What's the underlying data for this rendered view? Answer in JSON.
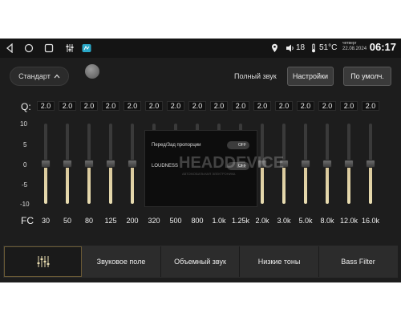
{
  "status_bar": {
    "volume": "18",
    "temperature": "51°C",
    "day": "четверг",
    "date": "22.08.2024",
    "time": "06:17",
    "icons": [
      "back-icon",
      "home-icon",
      "recent-apps-icon",
      "equalizer-icon",
      "app-icon",
      "location-icon",
      "volume-icon",
      "temperature-icon"
    ]
  },
  "top": {
    "preset": "Стандарт",
    "full_sound": "Полный звук",
    "settings": "Настройки",
    "default": "По умолч."
  },
  "eq": {
    "q_label": "Q:",
    "fc_label": "FC",
    "scale": [
      "10",
      "5",
      "0",
      "-5",
      "-10"
    ],
    "bands": [
      {
        "q": "2.0",
        "freq": "30",
        "gain": 0
      },
      {
        "q": "2.0",
        "freq": "50",
        "gain": 0
      },
      {
        "q": "2.0",
        "freq": "80",
        "gain": 0
      },
      {
        "q": "2.0",
        "freq": "125",
        "gain": 0
      },
      {
        "q": "2.0",
        "freq": "200",
        "gain": 0
      },
      {
        "q": "2.0",
        "freq": "320",
        "gain": 0
      },
      {
        "q": "2.0",
        "freq": "500",
        "gain": 0
      },
      {
        "q": "2.0",
        "freq": "800",
        "gain": 0
      },
      {
        "q": "2.0",
        "freq": "1.0k",
        "gain": 0
      },
      {
        "q": "2.0",
        "freq": "1.25k",
        "gain": 0
      },
      {
        "q": "2.0",
        "freq": "2.0k",
        "gain": 0
      },
      {
        "q": "2.0",
        "freq": "3.0k",
        "gain": 0
      },
      {
        "q": "2.0",
        "freq": "5.0k",
        "gain": 0
      },
      {
        "q": "2.0",
        "freq": "8.0k",
        "gain": 0
      },
      {
        "q": "2.0",
        "freq": "12.0k",
        "gain": 0
      },
      {
        "q": "2.0",
        "freq": "16.0k",
        "gain": 0
      }
    ]
  },
  "panel": {
    "front_rear_label": "Перед/Зад пропорции",
    "front_rear_state": "OFF",
    "loudness_label": "LOUDNESS",
    "loudness_state": "OFF",
    "watermark": "HEADDEVICE",
    "watermark_sub": "АВТОМОБИЛЬНАЯ ЭЛЕКТРОНИКА"
  },
  "tabs": {
    "eq_icon": "equalizer-sliders-icon",
    "sound_field": "Звуковое поле",
    "surround": "Объемный звук",
    "low_tones": "Низкие тоны",
    "bass_filter": "Bass Filter"
  },
  "colors": {
    "background": "#1d1d1d",
    "slider_fill": "#e8dcb0",
    "active_tab_border": "#6a5a35"
  }
}
